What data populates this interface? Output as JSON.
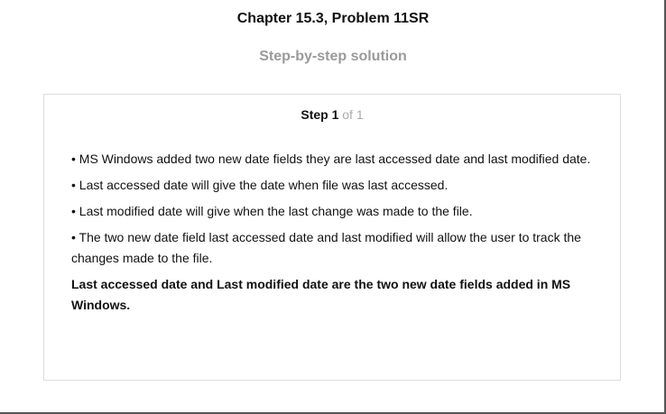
{
  "page": {
    "title": "Chapter 15.3, Problem 11SR",
    "subtitle": "Step-by-step solution"
  },
  "step": {
    "label": "Step 1",
    "of": "of 1",
    "bullets": [
      "• MS Windows added two new date fields they are last accessed date and last modified date.",
      "• Last accessed date will give the date when file was last accessed.",
      "• Last modified date will give when the last change was made to the file.",
      "• The two new date field last accessed date and last modified will allow the user to track the changes made to the file."
    ],
    "answer": "Last accessed date and Last modified date are the two new date fields added in MS Windows."
  }
}
